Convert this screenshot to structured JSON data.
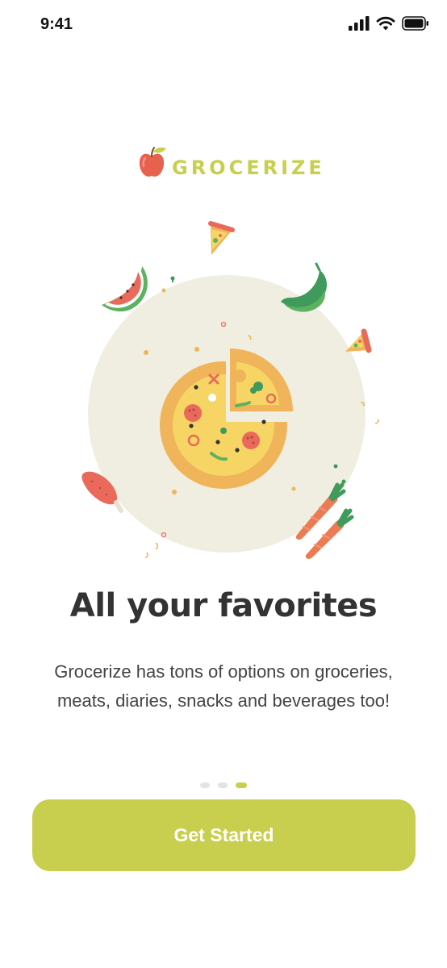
{
  "status_bar": {
    "time": "9:41",
    "icons": [
      "cellular-signal-icon",
      "wifi-icon",
      "battery-icon"
    ]
  },
  "logo": {
    "text": "GROCERIZE",
    "icon": "apple-icon"
  },
  "illustration": {
    "items": [
      "pizza-icon",
      "watermelon-slice-icon",
      "pizza-slice-icon",
      "banana-icon",
      "sausage-icon",
      "carrot-icon"
    ]
  },
  "onboarding": {
    "headline": "All your favorites",
    "description": "Grocerize has tons of options on groceries, meats, diaries, snacks and beverages too!",
    "page_count": 3,
    "active_page": 3
  },
  "cta": {
    "label": "Get Started"
  },
  "colors": {
    "accent": "#c8cf4e",
    "headline": "#333333",
    "body": "#444444",
    "circle_bg": "#f0eee0",
    "pizza_crust": "#f0b45a",
    "pizza_cheese": "#f7d564",
    "tomato": "#e96a5a"
  }
}
